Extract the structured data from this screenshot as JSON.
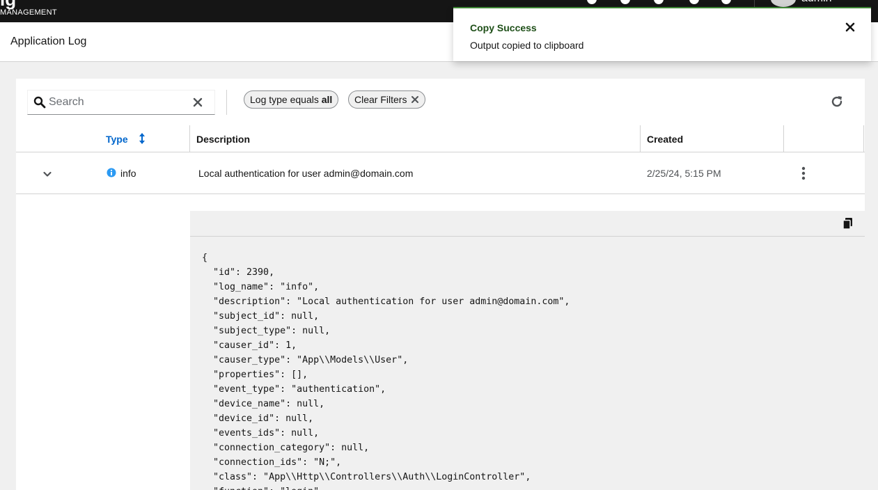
{
  "topbar": {
    "brand_partial": "ig",
    "brand_sub": "MANAGEMENT",
    "user_name": "admin"
  },
  "page": {
    "title": "Application Log"
  },
  "toolbar": {
    "search_placeholder": "Search",
    "filter_chip_prefix": "Log type equals",
    "filter_chip_value": "all",
    "clear_filters_label": "Clear Filters"
  },
  "table": {
    "columns": {
      "type": "Type",
      "description": "Description",
      "created": "Created"
    },
    "rows": [
      {
        "type": "info",
        "description": "Local authentication for user admin@domain.com",
        "created": "2/25/24, 5:15 PM"
      }
    ]
  },
  "detail": {
    "json_lines": [
      "{",
      "  \"id\": 2390,",
      "  \"log_name\": \"info\",",
      "  \"description\": \"Local authentication for user admin@domain.com\",",
      "  \"subject_id\": null,",
      "  \"subject_type\": null,",
      "  \"causer_id\": 1,",
      "  \"causer_type\": \"App\\\\Models\\\\User\",",
      "  \"properties\": [],",
      "  \"event_type\": \"authentication\",",
      "  \"device_name\": null,",
      "  \"device_id\": null,",
      "  \"events_ids\": null,",
      "  \"connection_category\": null,",
      "  \"connection_ids\": \"N;\",",
      "  \"class\": \"App\\\\Http\\\\Controllers\\\\Auth\\\\LoginController\",",
      "  \"function\": \"login\","
    ]
  },
  "toast": {
    "title": "Copy Success",
    "message": "Output copied to clipboard"
  },
  "colors": {
    "link_blue": "#0066cc",
    "success_green": "#3e8635",
    "success_title": "#1e4f18",
    "topbar_bg": "#151515",
    "page_bg": "#f0f0f0"
  }
}
